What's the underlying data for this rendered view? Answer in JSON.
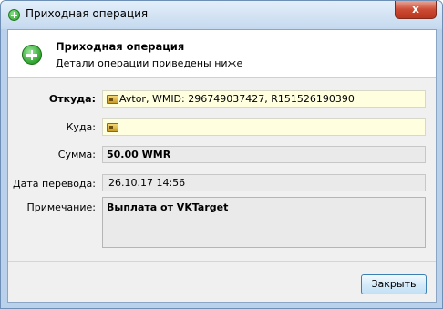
{
  "window": {
    "title": "Приходная операция",
    "close_symbol": "x"
  },
  "header": {
    "title": "Приходная операция",
    "subtitle": "Детали операции приведены ниже",
    "icon": "plus-circle-icon"
  },
  "fields": {
    "from": {
      "label": "Откуда:",
      "value": "Avtor, WMID: 296749037427, R151526190390"
    },
    "to": {
      "label": "Куда:",
      "value": ""
    },
    "amount": {
      "label": "Сумма:",
      "value": "50.00 WMR"
    },
    "date": {
      "label": "Дата перевода:",
      "value": "26.10.17 14:56"
    },
    "note": {
      "label": "Примечание:",
      "value": "Выплата от VKTarget"
    }
  },
  "buttons": {
    "close_label": "Закрыть"
  },
  "colors": {
    "accent_border": "#3c7fb1",
    "yellow_field": "#ffffe0",
    "icon_green": "#2ea32e"
  }
}
